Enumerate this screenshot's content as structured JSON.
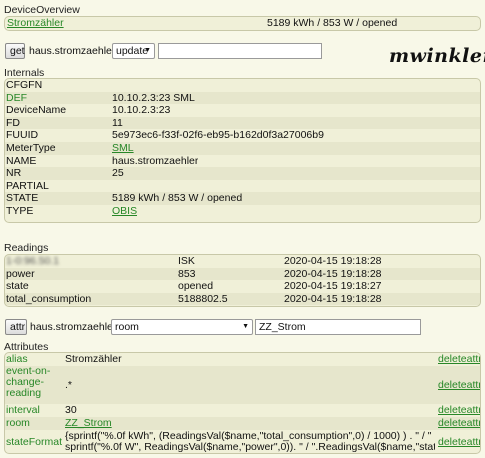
{
  "device_overview": {
    "title": "DeviceOverview",
    "device_link": "Stromzähler",
    "status": "5189 kWh / 853 W / opened"
  },
  "command_bar": {
    "get_button": "get",
    "device_name": "haus.stromzaehler",
    "reading_select": "update",
    "value_input": ""
  },
  "logo_text": "mwinkler",
  "internals": {
    "title": "Internals",
    "rows": [
      {
        "key": "CFGFN",
        "value": ""
      },
      {
        "key": "DEF",
        "value": "10.10.2.3:23 SML"
      },
      {
        "key": "DeviceName",
        "value": "10.10.2.3:23"
      },
      {
        "key": "FD",
        "value": "11"
      },
      {
        "key": "FUUID",
        "value": "5e973ec6-f33f-02f6-eb95-b162d0f3a27006b9"
      },
      {
        "key": "MeterType",
        "value": "SML"
      },
      {
        "key": "NAME",
        "value": "haus.stromzaehler"
      },
      {
        "key": "NR",
        "value": "25"
      },
      {
        "key": "PARTIAL",
        "value": ""
      },
      {
        "key": "STATE",
        "value": "5189 kWh / 853 W / opened"
      },
      {
        "key": "TYPE",
        "value": "OBIS"
      }
    ]
  },
  "readings": {
    "title": "Readings",
    "rows": [
      {
        "name": "1-0:96.50.1",
        "value": "ISK",
        "time": "2020-04-15 19:18:28"
      },
      {
        "name": "power",
        "value": "853",
        "time": "2020-04-15 19:18:28"
      },
      {
        "name": "state",
        "value": "opened",
        "time": "2020-04-15 19:18:27"
      },
      {
        "name": "total_consumption",
        "value": "5188802.5",
        "time": "2020-04-15 19:18:28"
      }
    ]
  },
  "attr_bar": {
    "attr_button": "attr",
    "device_name": "haus.stromzaehler",
    "attr_select": "room",
    "value_input": "ZZ_Strom"
  },
  "attributes": {
    "title": "Attributes",
    "delete_label": "deleteattr",
    "rows": [
      {
        "name": "alias",
        "value": "Stromzähler"
      },
      {
        "name": "event-on-change-reading",
        "value": ".*"
      },
      {
        "name": "interval",
        "value": "30"
      },
      {
        "name": "room",
        "value": "ZZ_Strom"
      },
      {
        "name": "stateFormat",
        "value_line1": "{sprintf(\"%.0f kWh\", (ReadingsVal($name,\"total_consumption\",0) / 1000) ) . \" / \" .",
        "value_line2": "sprintf(\"%.0f W\", ReadingsVal($name,\"power\",0)). \" / \".ReadingsVal($name,\"state\",0)}"
      }
    ]
  }
}
